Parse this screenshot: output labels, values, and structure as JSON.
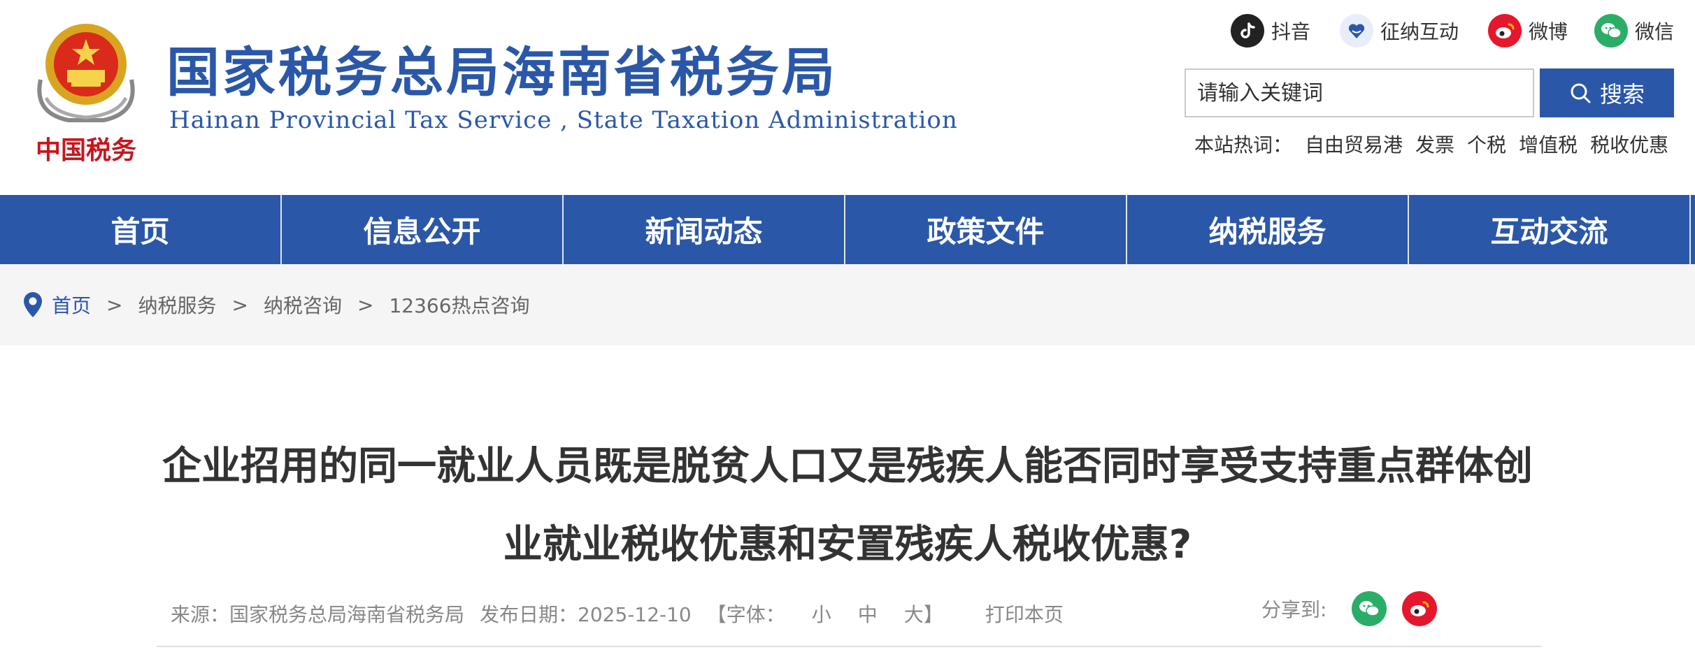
{
  "header": {
    "emblem_caption": "中国税务",
    "title_cn": "国家税务总局海南省税务局",
    "title_en": "Hainan  Provincial  Tax  Service , State  Taxation  Administration"
  },
  "social": [
    {
      "label": "抖音",
      "icon": "douyin-icon",
      "color": "#222222"
    },
    {
      "label": "征纳互动",
      "icon": "heart-hands-icon",
      "color": "#2a57a8"
    },
    {
      "label": "微博",
      "icon": "weibo-icon",
      "color": "#e6162d"
    },
    {
      "label": "微信",
      "icon": "wechat-icon",
      "color": "#2aae67"
    }
  ],
  "search": {
    "placeholder": "请输入关键词",
    "button_label": "搜索"
  },
  "hotwords": {
    "label": "本站热词：",
    "items": [
      "自由贸易港",
      "发票",
      "个税",
      "增值税",
      "税收优惠"
    ]
  },
  "nav": [
    "首页",
    "信息公开",
    "新闻动态",
    "政策文件",
    "纳税服务",
    "互动交流"
  ],
  "breadcrumb": {
    "items": [
      "首页",
      "纳税服务",
      "纳税咨询",
      "12366热点咨询"
    ],
    "separator": ">"
  },
  "article": {
    "title_line1": "企业招用的同一就业人员既是脱贫人口又是残疾人能否同时享受支持重点群体创",
    "title_line2": "业就业税收优惠和安置残疾人税收优惠?",
    "source": "来源：国家税务总局海南省税务局",
    "date": "发布日期：2025-12-10",
    "font_open": "【字体：",
    "font_small": "小",
    "font_medium": "中",
    "font_large": "大",
    "font_close": "】",
    "print": "打印本页",
    "share_label": "分享到:"
  },
  "colors": {
    "brand_blue": "#2a57a8",
    "wechat_green": "#2aae67",
    "weibo_red": "#e6162d"
  }
}
